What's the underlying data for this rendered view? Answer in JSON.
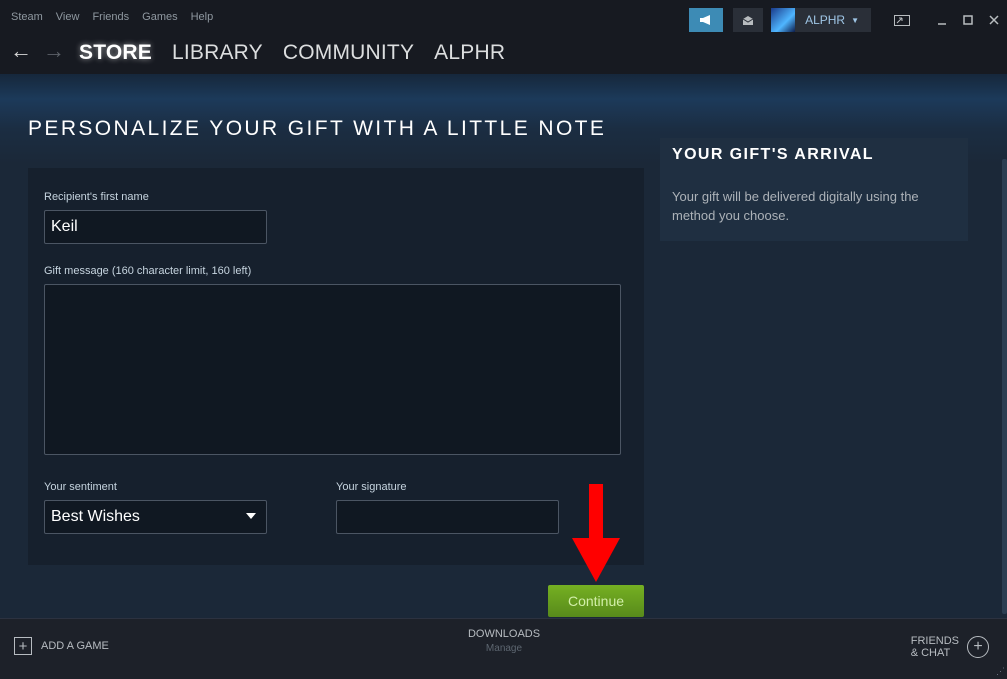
{
  "menu": [
    "Steam",
    "View",
    "Friends",
    "Games",
    "Help"
  ],
  "account": {
    "name": "ALPHR"
  },
  "nav": {
    "back": "←",
    "forward": "→",
    "links": [
      "STORE",
      "LIBRARY",
      "COMMUNITY",
      "ALPHR"
    ],
    "active": "STORE"
  },
  "page": {
    "title": "PERSONALIZE YOUR GIFT WITH A LITTLE NOTE"
  },
  "form": {
    "recipient_label": "Recipient's first name",
    "recipient_value": "Keil",
    "message_label": "Gift message (160 character limit, 160 left)",
    "message_value": "",
    "sentiment_label": "Your sentiment",
    "sentiment_value": "Best Wishes",
    "signature_label": "Your signature",
    "signature_value": "",
    "continue_label": "Continue"
  },
  "arrival": {
    "title": "YOUR GIFT'S ARRIVAL",
    "text": "Your gift will be delivered digitally using the method you choose."
  },
  "bottom": {
    "add_game": "ADD A GAME",
    "downloads": "DOWNLOADS",
    "downloads_sub": "Manage",
    "friends_line1": "FRIENDS",
    "friends_line2": "& CHAT"
  },
  "colors": {
    "accent": "#3d8bb5",
    "continue": "#75b022",
    "annotation": "#ff0000"
  }
}
